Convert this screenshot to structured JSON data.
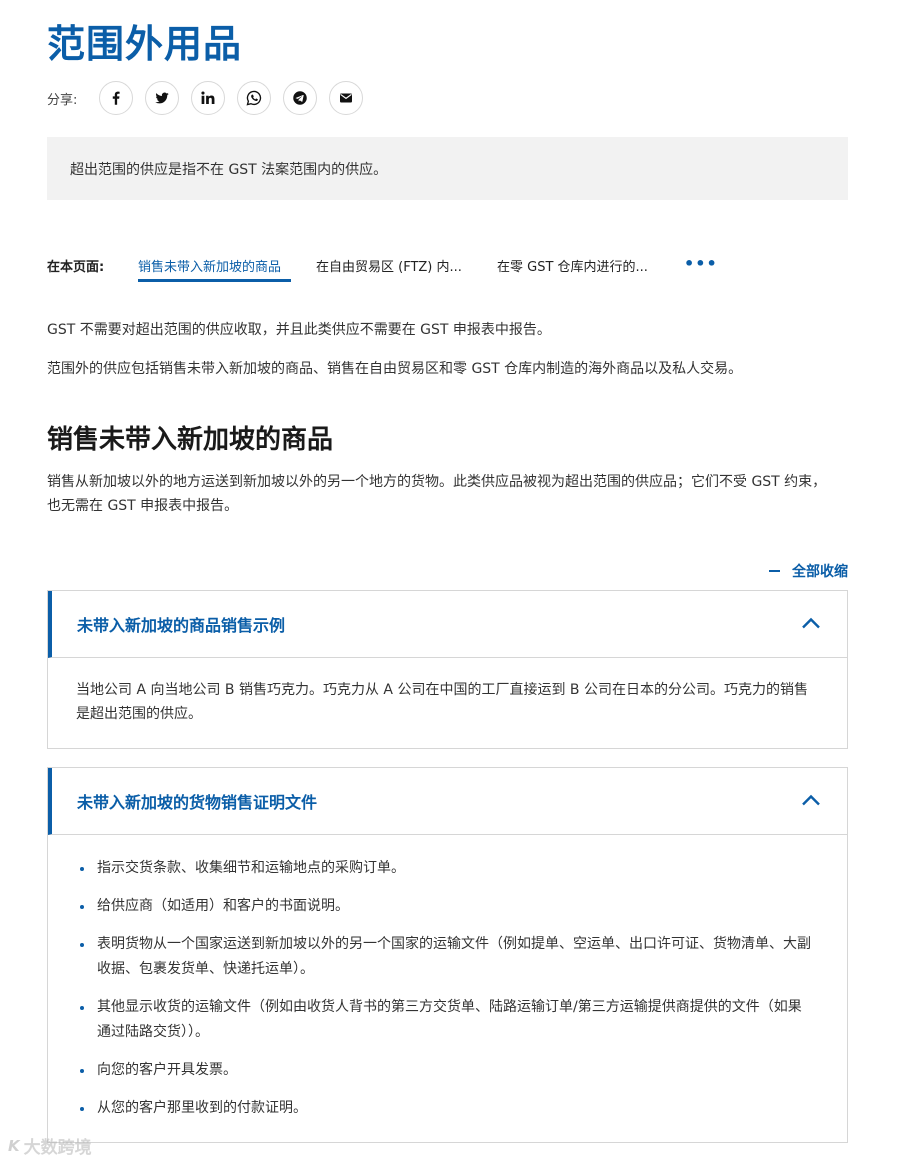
{
  "page": {
    "title": "范围外用品"
  },
  "share": {
    "label": "分享:",
    "buttons": [
      {
        "name": "facebook-icon"
      },
      {
        "name": "twitter-icon"
      },
      {
        "name": "linkedin-icon"
      },
      {
        "name": "whatsapp-icon"
      },
      {
        "name": "telegram-icon"
      },
      {
        "name": "email-icon"
      }
    ]
  },
  "callout": {
    "text": "超出范围的供应是指不在 GST 法案范围内的供应。"
  },
  "on_this_page": {
    "label": "在本页面:",
    "links": [
      {
        "label": "销售未带入新加坡的商品",
        "active": true
      },
      {
        "label": "在自由贸易区 (FTZ) 内...",
        "active": false
      },
      {
        "label": "在零 GST 仓库内进行的...",
        "active": false
      }
    ],
    "more": "•••"
  },
  "intro": {
    "p1": "GST 不需要对超出范围的供应收取，并且此类供应不需要在 GST 申报表中报告。",
    "p2": "范围外的供应包括销售未带入新加坡的商品、销售在自由贸易区和零 GST 仓库内制造的海外商品以及私人交易。"
  },
  "section": {
    "heading": "销售未带入新加坡的商品",
    "body": "销售从新加坡以外的地方运送到新加坡以外的另一个地方的货物。此类供应品被视为超出范围的供应品；它们不受 GST 约束，也无需在 GST 申报表中报告。"
  },
  "collapse_all": {
    "label": "全部收缩"
  },
  "accordion_1": {
    "title": "未带入新加坡的商品销售示例",
    "body": "当地公司 A 向当地公司 B 销售巧克力。巧克力从 A 公司在中国的工厂直接运到 B 公司在日本的分公司。巧克力的销售是超出范围的供应。"
  },
  "accordion_2": {
    "title": "未带入新加坡的货物销售证明文件",
    "items": [
      "指示交货条款、收集细节和运输地点的采购订单。",
      "给供应商（如适用）和客户的书面说明。",
      "表明货物从一个国家运送到新加坡以外的另一个国家的运输文件（例如提单、空运单、出口许可证、货物清单、大副收据、包裹发货单、快递托运单）。",
      "其他显示收货的运输文件（例如由收货人背书的第三方交货单、陆路运输订单/第三方运输提供商提供的文件（如果通过陆路交货））。",
      "向您的客户开具发票。",
      "从您的客户那里收到的付款证明。"
    ]
  },
  "watermark": {
    "logo": "K",
    "text": "大数跨境"
  },
  "colors": {
    "accent": "#0b5ea8",
    "callout_bg": "#f2f2f2"
  }
}
